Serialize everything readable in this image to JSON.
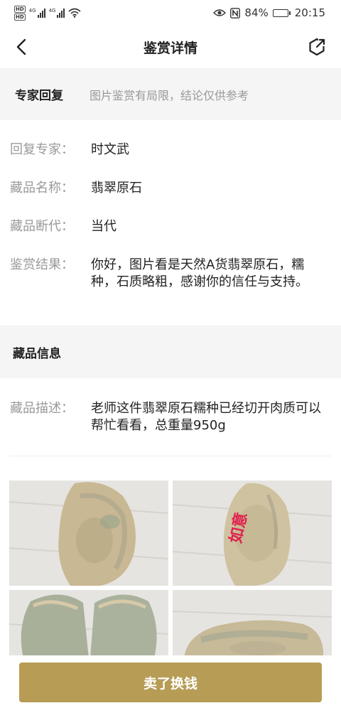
{
  "status_bar": {
    "hd1": "HD",
    "hd2": "HD",
    "net1": "4G",
    "net2": "4G",
    "battery_pct": "84%",
    "battery_level": 0.84,
    "time": "20:15"
  },
  "header": {
    "title": "鉴赏详情"
  },
  "expert": {
    "label": "专家回复",
    "note": "图片鉴赏有局限，结论仅供参考"
  },
  "info": [
    {
      "key": "回复专家：",
      "value": "时文武"
    },
    {
      "key": "藏品名称：",
      "value": "翡翠原石"
    },
    {
      "key": "藏品断代：",
      "value": "当代"
    },
    {
      "key": "鉴赏结果：",
      "value": "你好，图片看是天然A货翡翠原石，糯种，石质略粗，感谢你的信任与支持。"
    }
  ],
  "collection": {
    "label": "藏品信息",
    "desc_key": "藏品描述：",
    "desc_value": "老师这件翡翠原石糯种已经切开肉质可以帮忙看看，总重量950g"
  },
  "photos": [
    {
      "name": "jade-photo-1",
      "marking": ""
    },
    {
      "name": "jade-photo-2",
      "marking": "如意"
    },
    {
      "name": "jade-photo-3",
      "marking": ""
    },
    {
      "name": "jade-photo-4",
      "marking": ""
    }
  ],
  "action": {
    "sell_label": "卖了换钱",
    "color": "#b69c55"
  }
}
